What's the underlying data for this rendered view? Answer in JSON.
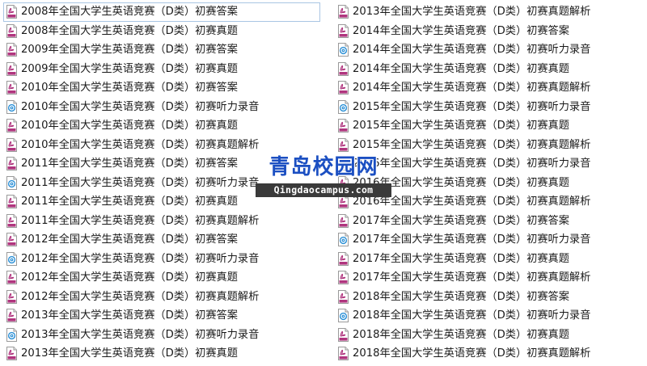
{
  "files": {
    "left": [
      {
        "name": "2008年全国大学生英语竞赛（D类）初赛答案",
        "icon": "pdf-file-icon"
      },
      {
        "name": "2008年全国大学生英语竞赛（D类）初赛真题",
        "icon": "pdf-file-icon"
      },
      {
        "name": "2009年全国大学生英语竞赛（D类）初赛答案",
        "icon": "pdf-file-icon"
      },
      {
        "name": "2009年全国大学生英语竞赛（D类）初赛真题",
        "icon": "pdf-file-icon"
      },
      {
        "name": "2010年全国大学生英语竞赛（D类）初赛答案",
        "icon": "pdf-file-icon"
      },
      {
        "name": "2010年全国大学生英语竞赛（D类）初赛听力录音",
        "icon": "audio-file-icon"
      },
      {
        "name": "2010年全国大学生英语竞赛（D类）初赛真题",
        "icon": "pdf-file-icon"
      },
      {
        "name": "2010年全国大学生英语竞赛（D类）初赛真题解析",
        "icon": "pdf-file-icon"
      },
      {
        "name": "2011年全国大学生英语竞赛（D类）初赛答案",
        "icon": "pdf-file-icon"
      },
      {
        "name": "2011年全国大学生英语竞赛（D类）初赛听力录音",
        "icon": "audio-file-icon"
      },
      {
        "name": "2011年全国大学生英语竞赛（D类）初赛真题",
        "icon": "pdf-file-icon"
      },
      {
        "name": "2011年全国大学生英语竞赛（D类）初赛真题解析",
        "icon": "pdf-file-icon"
      },
      {
        "name": "2012年全国大学生英语竞赛（D类）初赛答案",
        "icon": "pdf-file-icon"
      },
      {
        "name": "2012年全国大学生英语竞赛（D类）初赛听力录音",
        "icon": "audio-file-icon"
      },
      {
        "name": "2012年全国大学生英语竞赛（D类）初赛真题",
        "icon": "pdf-file-icon"
      },
      {
        "name": "2012年全国大学生英语竞赛（D类）初赛真题解析",
        "icon": "pdf-file-icon"
      },
      {
        "name": "2013年全国大学生英语竞赛（D类）初赛答案",
        "icon": "pdf-file-icon"
      },
      {
        "name": "2013年全国大学生英语竞赛（D类）初赛听力录音",
        "icon": "audio-file-icon"
      },
      {
        "name": "2013年全国大学生英语竞赛（D类）初赛真题",
        "icon": "pdf-file-icon"
      }
    ],
    "right": [
      {
        "name": "2013年全国大学生英语竞赛（D类）初赛真题解析",
        "icon": "pdf-file-icon"
      },
      {
        "name": "2014年全国大学生英语竞赛（D类）初赛答案",
        "icon": "pdf-file-icon"
      },
      {
        "name": "2014年全国大学生英语竞赛（D类）初赛听力录音",
        "icon": "audio-file-icon"
      },
      {
        "name": "2014年全国大学生英语竞赛（D类）初赛真题",
        "icon": "pdf-file-icon"
      },
      {
        "name": "2014年全国大学生英语竞赛（D类）初赛真题解析",
        "icon": "pdf-file-icon"
      },
      {
        "name": "2015年全国大学生英语竞赛（D类）初赛听力录音",
        "icon": "audio-file-icon"
      },
      {
        "name": "2015年全国大学生英语竞赛（D类）初赛真题",
        "icon": "pdf-file-icon"
      },
      {
        "name": "2015年全国大学生英语竞赛（D类）初赛真题解析",
        "icon": "pdf-file-icon"
      },
      {
        "name": "2016年全国大学生英语竞赛（D类）初赛听力录音",
        "icon": "audio-file-icon"
      },
      {
        "name": "2016年全国大学生英语竞赛（D类）初赛真题",
        "icon": "pdf-file-icon"
      },
      {
        "name": "2016年全国大学生英语竞赛（D类）初赛真题解析",
        "icon": "pdf-file-icon"
      },
      {
        "name": "2017年全国大学生英语竞赛（D类）初赛答案",
        "icon": "pdf-file-icon"
      },
      {
        "name": "2017年全国大学生英语竞赛（D类）初赛听力录音",
        "icon": "audio-file-icon"
      },
      {
        "name": "2017年全国大学生英语竞赛（D类）初赛真题",
        "icon": "pdf-file-icon"
      },
      {
        "name": "2017年全国大学生英语竞赛（D类）初赛真题解析",
        "icon": "pdf-file-icon"
      },
      {
        "name": "2018年全国大学生英语竞赛（D类）初赛答案",
        "icon": "pdf-file-icon"
      },
      {
        "name": "2018年全国大学生英语竞赛（D类）初赛听力录音",
        "icon": "audio-file-icon"
      },
      {
        "name": "2018年全国大学生英语竞赛（D类）初赛真题",
        "icon": "pdf-file-icon"
      },
      {
        "name": "2018年全国大学生英语竞赛（D类）初赛真题解析",
        "icon": "pdf-file-icon"
      }
    ]
  },
  "focused_item": "left.0",
  "colors": {
    "pdf_accent": "#b0357e",
    "audio_accent": "#2a8fd6",
    "focus_border": "#a9c5e3",
    "watermark_blue": "#1b4fc2",
    "watermark_bar": "#3a3a3a"
  },
  "watermark": {
    "cn": "青岛校园网",
    "en": "Qingdaocampus.com"
  }
}
